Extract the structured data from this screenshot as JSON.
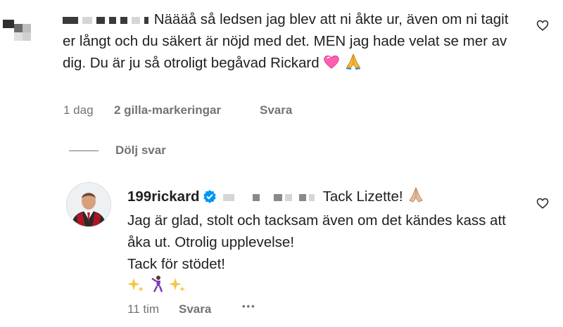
{
  "comment": {
    "text": "Näääå så ledsen jag blev att ni åkte ur, även om ni tagit er långt och du säkert är nöjd med det. MEN jag hade velat se mer av dig. Du är ju så otroligt begåvad Rickard",
    "time": "1 dag",
    "likes": "2 gilla-markeringar",
    "reply": "Svara"
  },
  "toggle_label": "Dölj svar",
  "reply": {
    "username": "199rickard",
    "line1": "Tack Lizette!",
    "body": "Jag är glad, stolt och tacksam även om det kändes kass att åka ut. Otrolig upplevelse!",
    "body2": "Tack för stödet!",
    "time": "11 tim",
    "reply": "Svara",
    "more": "•••"
  },
  "icons": {
    "like_first": "heart-outline-icon",
    "like_reply": "heart-outline-icon",
    "verified": "verified-badge-icon",
    "pink_heart": "pink-heart-emoji",
    "praying_hands": "folded-hands-emoji",
    "sparkles": "sparkles-emoji",
    "dancer": "man-dancing-emoji"
  },
  "colors": {
    "text": "#1f1f1f",
    "secondary": "#737373",
    "verified": "#0095f6",
    "pink_heart": "#ff5fb0"
  }
}
